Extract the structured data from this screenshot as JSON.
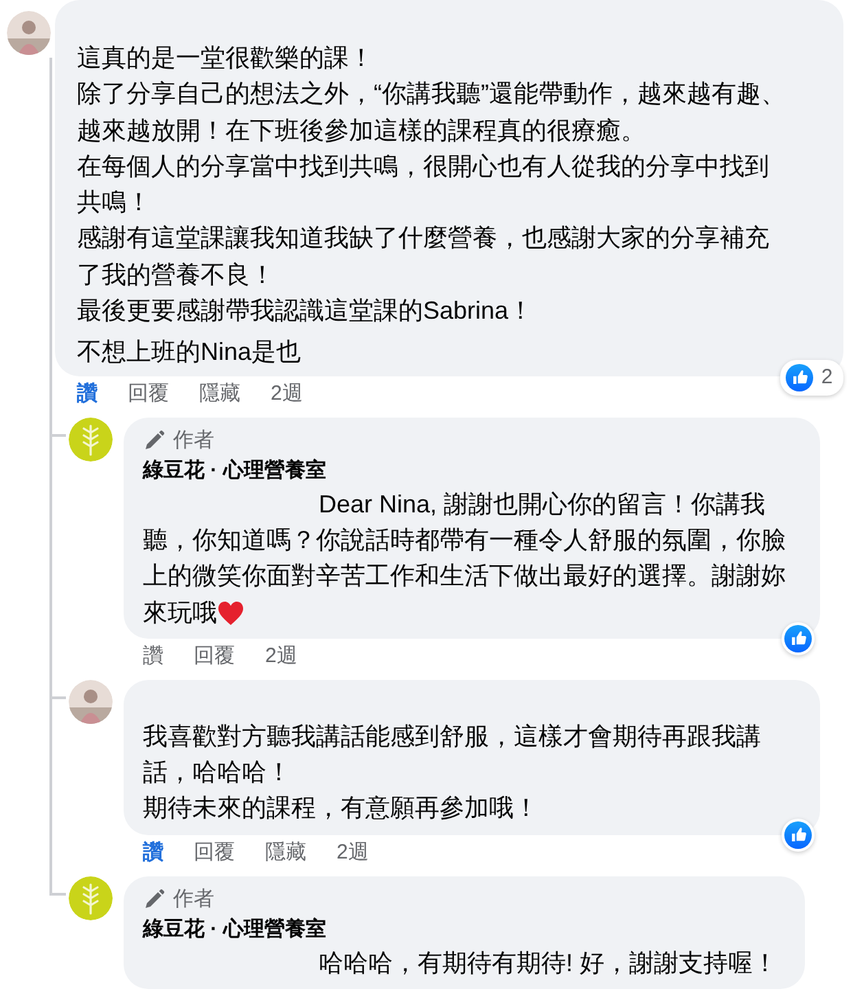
{
  "comment": {
    "paragraphs": [
      "這真的是一堂很歡樂的課！",
      "除了分享自己的想法之外，“你講我聽”還能帶動作，越來越有趣、越來越放開！在下班後參加這樣的課程真的很療癒。",
      "在每個人的分享當中找到共鳴，很開心也有人從我的分享中找到共鳴！",
      "感謝有這堂課讓我知道我缺了什麼營養，也感謝大家的分享補充了我的營養不良！",
      "最後更要感謝帶我認識這堂課的Sabrina！",
      "不想上班的Nina是也"
    ],
    "liked": true,
    "actions": [
      "讚",
      "回覆",
      "隱藏"
    ],
    "time": "2週",
    "reacted": true,
    "reaction_count": "2"
  },
  "replies": [
    {
      "kind": "author_reply",
      "author_badge": "作者",
      "author": "綠豆花 · 心理營養室",
      "paragraphs": [
        "Dear Nina, 謝謝也開心你的留言！你講我聽，你知道嗎？你說話時都帶有一種令人舒服的氛圍，你臉上的微笑你面對辛苦工作和生活下做出最好的選擇。謝謝妳來玩哦"
      ],
      "heart": true,
      "liked": false,
      "actions": [
        "讚",
        "回覆"
      ],
      "time": "2週",
      "reacted": true
    },
    {
      "kind": "reply",
      "paragraphs": [
        "我喜歡對方聽我講話能感到舒服，這樣才會期待再跟我講話，哈哈哈！",
        "期待未來的課程，有意願再參加哦！"
      ],
      "liked": true,
      "actions": [
        "讚",
        "回覆",
        "隱藏"
      ],
      "time": "2週",
      "reacted": true
    },
    {
      "kind": "author_reply",
      "author_badge": "作者",
      "author": "綠豆花 · 心理營養室",
      "paragraphs": [
        "哈哈哈，有期待有期待! 好，謝謝支持喔！"
      ]
    }
  ]
}
